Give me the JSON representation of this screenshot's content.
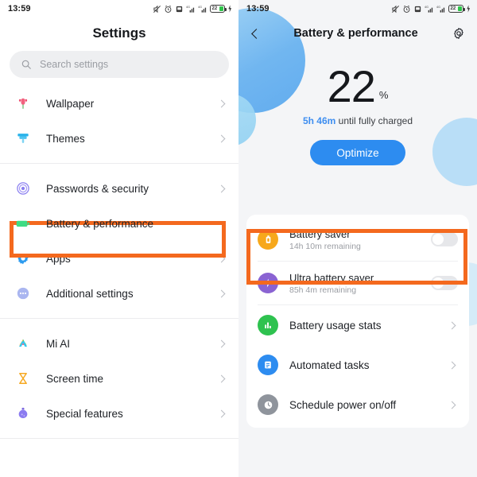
{
  "left": {
    "status": {
      "time": "13:59",
      "icons": [
        "mute-icon",
        "alarm-icon",
        "sd-card-icon",
        "signal-1-icon",
        "signal-2-icon",
        "battery-icon",
        "charging-bolt-icon"
      ],
      "battery_level": "22"
    },
    "title": "Settings",
    "search": {
      "placeholder": "Search settings",
      "icon": "search-icon"
    },
    "groups": [
      {
        "items": [
          {
            "label": "Wallpaper",
            "icon": "tulip-icon",
            "chevron": true,
            "highlighted": false
          },
          {
            "label": "Themes",
            "icon": "paint-brush-icon",
            "chevron": true,
            "highlighted": false
          }
        ]
      },
      {
        "items": [
          {
            "label": "Passwords & security",
            "icon": "fingerprint-icon",
            "chevron": true,
            "highlighted": false
          },
          {
            "label": "Battery & performance",
            "icon": "battery-green-icon",
            "chevron": false,
            "highlighted": true
          },
          {
            "label": "Apps",
            "icon": "gear-blue-icon",
            "chevron": true,
            "highlighted": false
          },
          {
            "label": "Additional settings",
            "icon": "dots-circle-icon",
            "chevron": true,
            "highlighted": false
          }
        ]
      },
      {
        "items": [
          {
            "label": "Mi AI",
            "icon": "mi-ai-icon",
            "chevron": true,
            "highlighted": false
          },
          {
            "label": "Screen time",
            "icon": "hourglass-icon",
            "chevron": true,
            "highlighted": false
          },
          {
            "label": "Special features",
            "icon": "flask-icon",
            "chevron": true,
            "highlighted": false
          }
        ]
      }
    ]
  },
  "right": {
    "status": {
      "time": "13:59",
      "battery_level": "22"
    },
    "appbar": {
      "back_icon": "back-chevron-icon",
      "title": "Battery & performance",
      "settings_icon": "gear-icon"
    },
    "hero": {
      "percent": "22",
      "percent_symbol": "%",
      "eta_highlight": "5h 46m",
      "eta_rest": " until fully charged",
      "optimize_label": "Optimize"
    },
    "savers": [
      {
        "title": "Battery saver",
        "subtitle": "14h 10m remaining",
        "icon": "battery-lock-icon",
        "icon_color": "#f7a81b",
        "toggle_on": false,
        "highlighted": true
      },
      {
        "title": "Ultra battery saver",
        "subtitle": "85h 4m remaining",
        "icon": "bolt-icon",
        "icon_color": "#8a63d2",
        "toggle_on": false,
        "highlighted": false
      }
    ],
    "nav_items": [
      {
        "label": "Battery usage stats",
        "icon": "bar-chart-icon",
        "icon_color": "#2ec24f"
      },
      {
        "label": "Automated tasks",
        "icon": "document-icon",
        "icon_color": "#2d8cf0"
      },
      {
        "label": "Schedule power on/off",
        "icon": "clock-icon",
        "icon_color": "#8f949c"
      }
    ]
  },
  "colors": {
    "highlight": "#f4691e",
    "accent_blue": "#2d8cf0",
    "panel_bg": "#f4f5f7"
  }
}
